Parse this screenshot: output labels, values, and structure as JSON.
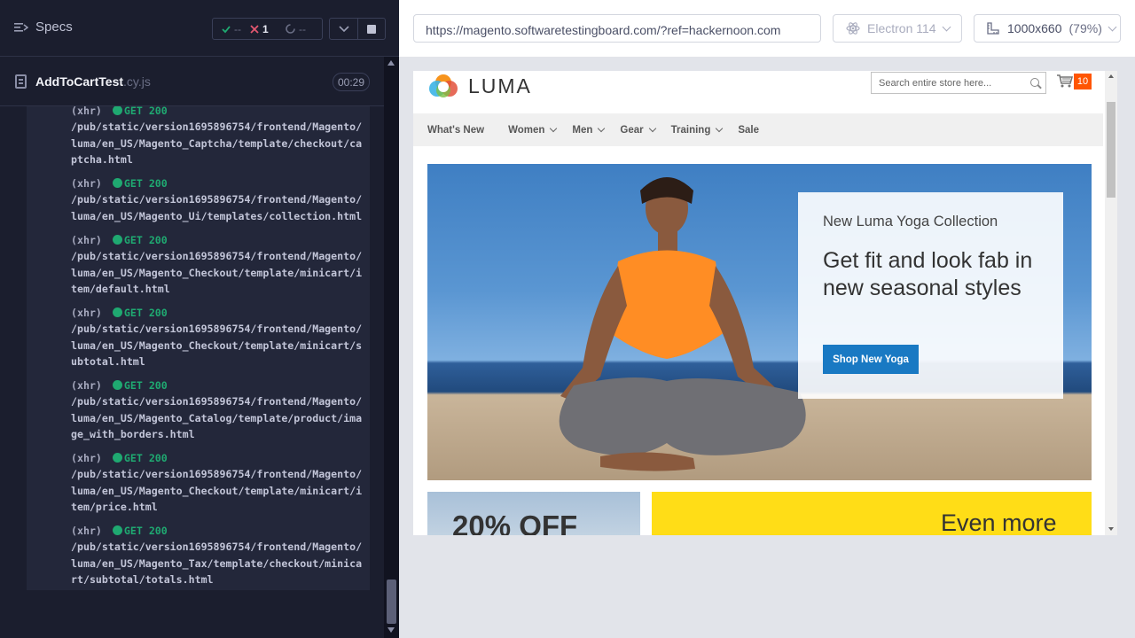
{
  "reporter": {
    "specs_label": "Specs",
    "stats": {
      "passed": "--",
      "failed": "1",
      "pending": "--"
    },
    "spec": {
      "name": "AddToCartTest",
      "ext": ".cy.js",
      "duration": "00:29"
    },
    "logs": [
      {
        "type": "(xhr)",
        "method": "GET 200",
        "path": "/pub/static/version1695896754/frontend/Magento/luma/en_US/Magento_Captcha/template/checkout/captcha.html"
      },
      {
        "type": "(xhr)",
        "method": "GET 200",
        "path": "/pub/static/version1695896754/frontend/Magento/luma/en_US/Magento_Ui/templates/collection.html"
      },
      {
        "type": "(xhr)",
        "method": "GET 200",
        "path": "/pub/static/version1695896754/frontend/Magento/luma/en_US/Magento_Checkout/template/minicart/item/default.html"
      },
      {
        "type": "(xhr)",
        "method": "GET 200",
        "path": "/pub/static/version1695896754/frontend/Magento/luma/en_US/Magento_Checkout/template/minicart/subtotal.html"
      },
      {
        "type": "(xhr)",
        "method": "GET 200",
        "path": "/pub/static/version1695896754/frontend/Magento/luma/en_US/Magento_Catalog/template/product/image_with_borders.html"
      },
      {
        "type": "(xhr)",
        "method": "GET 200",
        "path": "/pub/static/version1695896754/frontend/Magento/luma/en_US/Magento_Checkout/template/minicart/item/price.html"
      },
      {
        "type": "(xhr)",
        "method": "GET 200",
        "path": "/pub/static/version1695896754/frontend/Magento/luma/en_US/Magento_Tax/template/checkout/minicart/subtotal/totals.html"
      }
    ]
  },
  "aut": {
    "url": "https://magento.softwaretestingboard.com/?ref=hackernoon.com",
    "browser": "Electron 114",
    "viewport": "1000x660",
    "zoom": "(79%)"
  },
  "site": {
    "logo": "LUMA",
    "search_placeholder": "Search entire store here...",
    "cart_count": "10",
    "nav": [
      {
        "label": "What's New",
        "has_menu": false
      },
      {
        "label": "Women",
        "has_menu": true
      },
      {
        "label": "Men",
        "has_menu": true
      },
      {
        "label": "Gear",
        "has_menu": true
      },
      {
        "label": "Training",
        "has_menu": true
      },
      {
        "label": "Sale",
        "has_menu": false
      }
    ],
    "hero": {
      "subtitle": "New Luma Yoga Collection",
      "title": "Get fit and look fab in new seasonal styles",
      "button": "Shop New Yoga"
    },
    "tile_left": "20% OFF",
    "tile_right": "Even more"
  },
  "colors": {
    "reporter_bg": "#1b1e2e",
    "success": "#1fa971",
    "failure": "#e45770",
    "luma_blue": "#1979c3",
    "cart_badge": "#ff5501",
    "promo_yellow": "#ffdd17"
  }
}
